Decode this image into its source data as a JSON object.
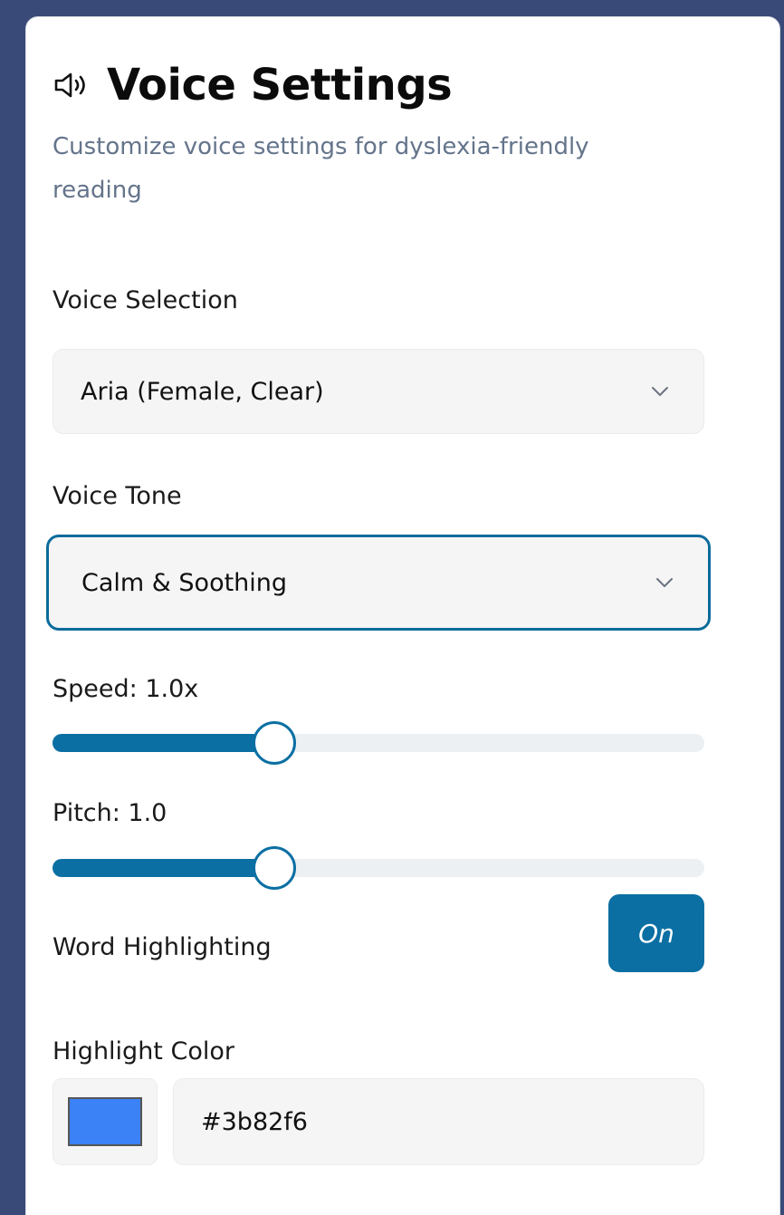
{
  "header": {
    "title": "Voice Settings",
    "icon": "speaker-icon",
    "subtitle": "Customize voice settings for dyslexia-friendly reading"
  },
  "voice_selection": {
    "label": "Voice Selection",
    "selected": "Aria (Female, Clear)"
  },
  "voice_tone": {
    "label": "Voice Tone",
    "selected": "Calm & Soothing"
  },
  "speed": {
    "label": "Speed: 1.0x",
    "value": 1.0,
    "fill_fraction": 0.34
  },
  "pitch": {
    "label": "Pitch: 1.0",
    "value": 1.0,
    "fill_fraction": 0.34
  },
  "word_highlighting": {
    "label": "Word Highlighting",
    "button_label": "On"
  },
  "highlight_color": {
    "label": "Highlight Color",
    "value": "#3b82f6"
  },
  "colors": {
    "accent": "#0b6fa3",
    "focus_border": "#0b6c9b",
    "highlight_swatch": "#3b82f6"
  }
}
